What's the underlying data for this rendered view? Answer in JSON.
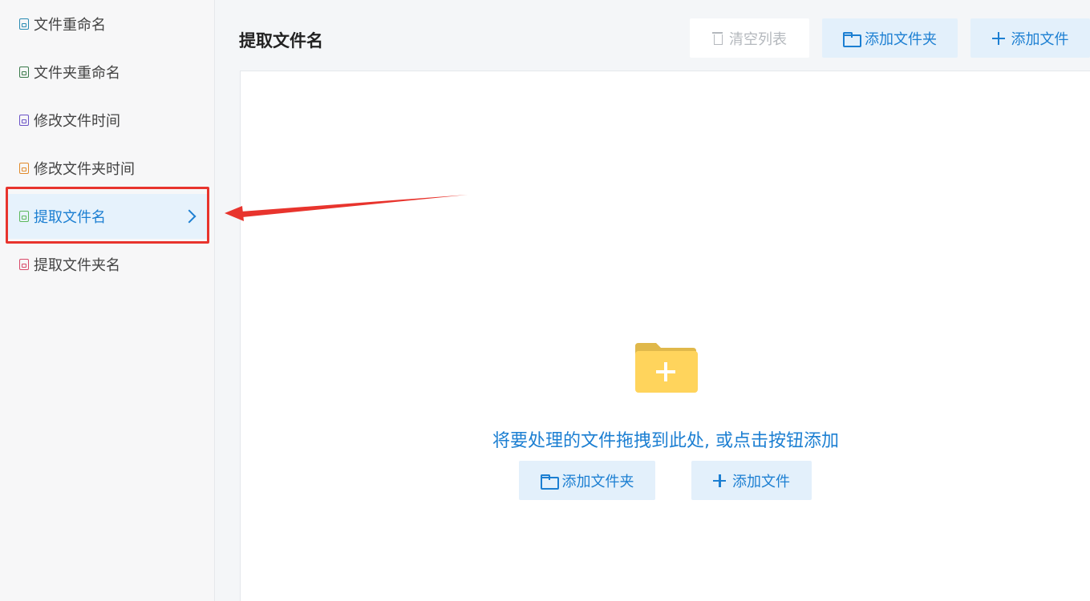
{
  "sidebar": {
    "items": [
      {
        "label": "文件重命名",
        "icon": "file-rename-icon",
        "color": "#2a8bb3"
      },
      {
        "label": "文件夹重命名",
        "icon": "folder-rename-icon",
        "color": "#3a7a4a"
      },
      {
        "label": "修改文件时间",
        "icon": "file-time-icon",
        "color": "#6b53c7"
      },
      {
        "label": "修改文件夹时间",
        "icon": "folder-time-icon",
        "color": "#e18a2c"
      },
      {
        "label": "提取文件名",
        "icon": "extract-filename-icon",
        "color": "#5cb85c",
        "active": true
      },
      {
        "label": "提取文件夹名",
        "icon": "extract-foldername-icon",
        "color": "#d94a6a"
      }
    ]
  },
  "header": {
    "title": "提取文件名",
    "clear_label": "清空列表",
    "add_folder_label": "添加文件夹",
    "add_file_label": "添加文件"
  },
  "dropzone": {
    "hint": "将要处理的文件拖拽到此处, 或点击按钮添加",
    "add_folder_label": "添加文件夹",
    "add_file_label": "添加文件"
  },
  "colors": {
    "accent": "#1c7fd2",
    "active_bg": "#e6f2fc",
    "annotation_red": "#e8342d",
    "folder_yellow": "#ffd45c"
  }
}
